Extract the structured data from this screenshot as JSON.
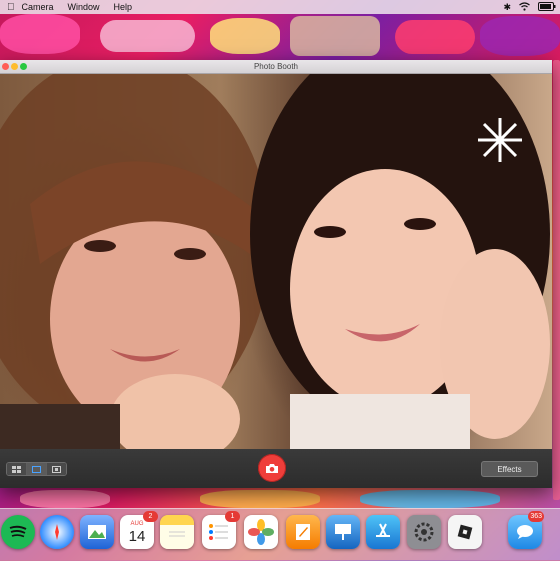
{
  "menubar": {
    "items": [
      "Camera",
      "Window",
      "Help"
    ]
  },
  "window": {
    "title": "Photo Booth"
  },
  "controls": {
    "effects_label": "Effects"
  },
  "dock": {
    "calendar": {
      "month": "AUG",
      "day": "14",
      "badge": "2"
    },
    "reminders_badge": "1",
    "messages_badge": "363"
  },
  "colors": {
    "shutter": "#ef3e3a",
    "window_bg": "#2b2b2b"
  }
}
